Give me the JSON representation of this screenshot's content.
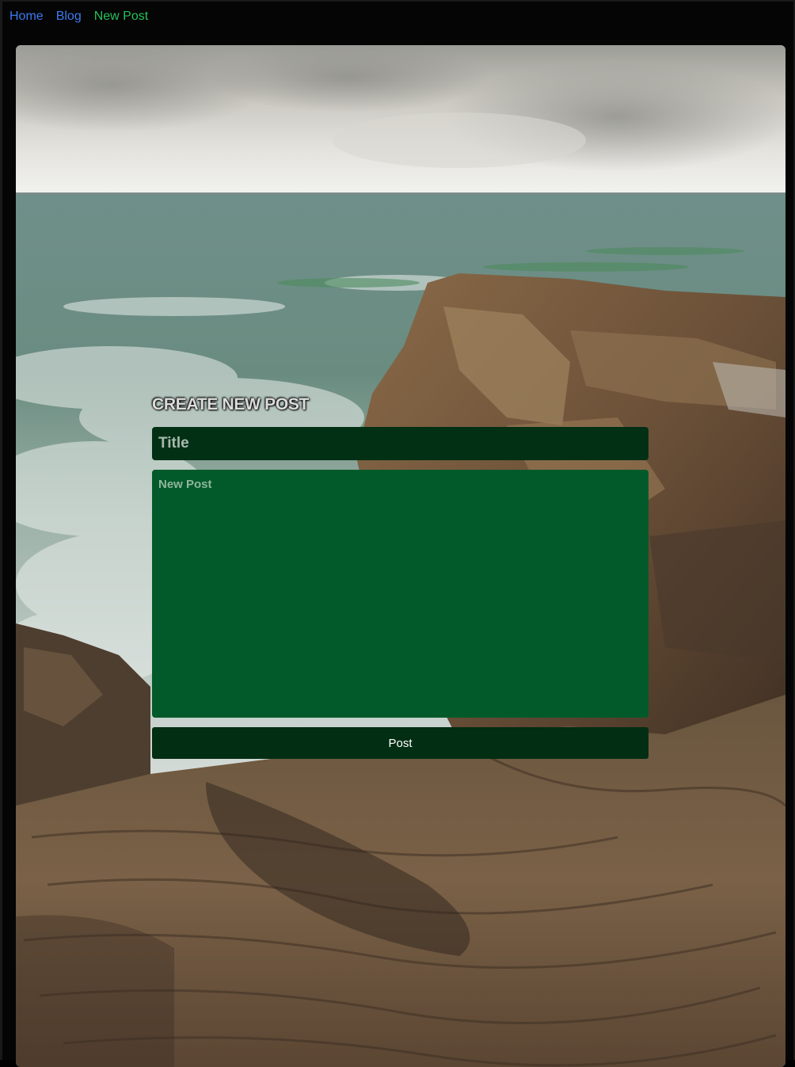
{
  "nav": {
    "items": [
      {
        "label": "Home",
        "color": "#3a7bf0"
      },
      {
        "label": "Blog",
        "color": "#3a7bf0"
      },
      {
        "label": "New Post",
        "color": "#25c25a"
      }
    ]
  },
  "hero": {
    "image": "coastal-cliffs-and-sea-photo"
  },
  "form": {
    "heading": "CREATE NEW POST",
    "title_placeholder": "Title",
    "title_value": "",
    "body_placeholder": "New Post",
    "body_value": "",
    "submit_label": "Post"
  },
  "colors": {
    "title_input_bg": "#023015",
    "textarea_bg": "#025a2a",
    "button_bg": "#022e13",
    "page_bg": "#050505"
  }
}
